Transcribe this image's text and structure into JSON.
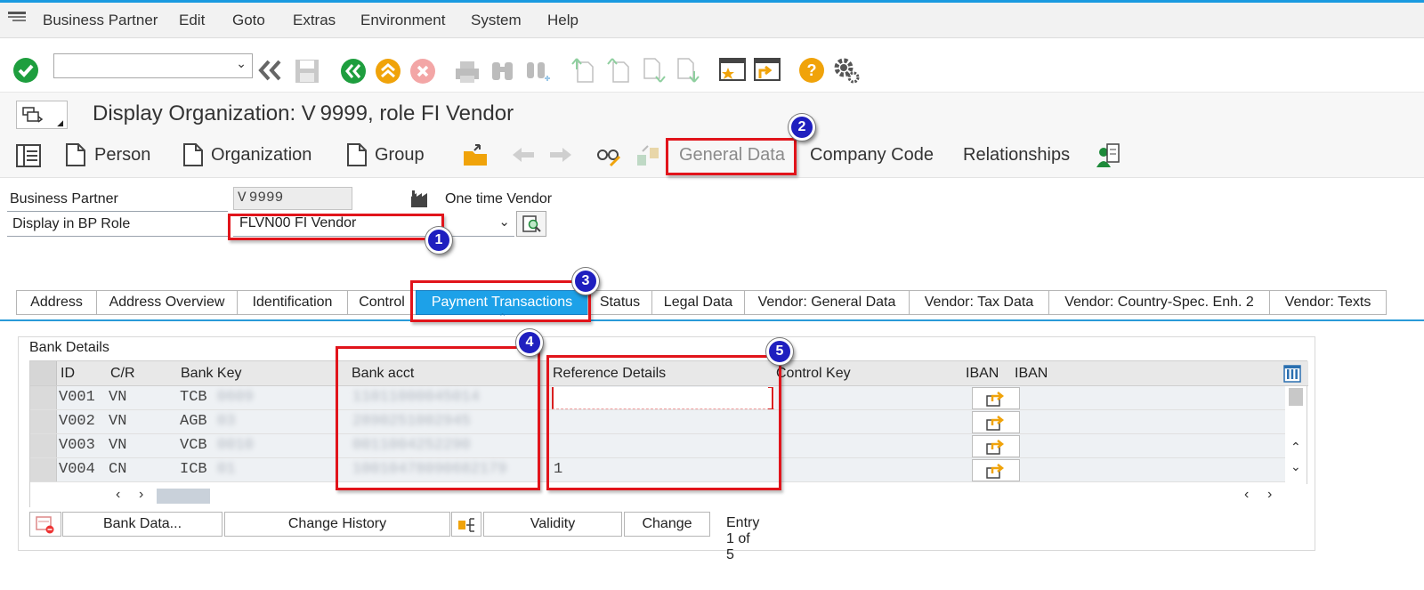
{
  "menu": {
    "items": [
      "Business Partner",
      "Edit",
      "Goto",
      "Extras",
      "Environment",
      "System",
      "Help"
    ]
  },
  "toolbar": {
    "command_value": "",
    "icons": [
      "check-icon",
      "dropdown-icon",
      "fast-back-icon",
      "save-icon",
      "back-icon",
      "exit-icon",
      "cancel-icon",
      "print-icon",
      "find-icon",
      "find-next-icon",
      "first-page-icon",
      "previous-page-icon",
      "next-page-icon",
      "last-page-icon",
      "create-session-icon",
      "shortcut-icon",
      "help-icon",
      "settings-icon"
    ]
  },
  "title": {
    "text": "Display Organization: V 9999, role FI Vendor"
  },
  "app_toolbar": {
    "person": "Person",
    "organization": "Organization",
    "group": "Group",
    "general_data": "General Data",
    "company_code": "Company Code",
    "relationships": "Relationships"
  },
  "header": {
    "bp_label": "Business Partner",
    "bp_value": "V 9999",
    "one_time": "One time Vendor",
    "role_label": "Display in BP Role",
    "role_value": "FLVN00 FI Vendor"
  },
  "tabs": [
    "Address",
    "Address Overview",
    "Identification",
    "Control",
    "Payment Transactions",
    "Status",
    "Legal Data",
    "Vendor: General Data",
    "Vendor: Tax Data",
    "Vendor: Country-Spec. Enh. 2",
    "Vendor: Texts"
  ],
  "active_tab": "Payment Transactions",
  "bank": {
    "group_title": "Bank Details",
    "columns": [
      "ID",
      "C/R",
      "Bank Key",
      "Bank acct",
      "Reference Details",
      "Control Key",
      "IBAN",
      "IBAN"
    ],
    "rows": [
      {
        "id": "V001",
        "cr": "VN",
        "bank_key": "TCB",
        "bank_key_hidden": "0609",
        "acct": "11011000045014",
        "ref": ""
      },
      {
        "id": "V002",
        "cr": "VN",
        "bank_key": "AGB",
        "bank_key_hidden": "03",
        "acct": "2890251002945",
        "ref": ""
      },
      {
        "id": "V003",
        "cr": "VN",
        "bank_key": "VCB",
        "bank_key_hidden": "0010",
        "acct": "0011004252290",
        "ref": ""
      },
      {
        "id": "V004",
        "cr": "CN",
        "bank_key": "ICB",
        "bank_key_hidden": "01",
        "acct": "10010478090682179",
        "ref": "1"
      }
    ],
    "buttons": {
      "bank_data": "Bank Data...",
      "change_history": "Change History",
      "validity": "Validity",
      "change": "Change"
    },
    "entry_text": "Entry 1 of 5"
  },
  "callouts": [
    "1",
    "2",
    "3",
    "4",
    "5"
  ],
  "colors": {
    "accent": "#1da1e8",
    "highlight": "#e1141b",
    "badge": "#1f1fbf"
  }
}
